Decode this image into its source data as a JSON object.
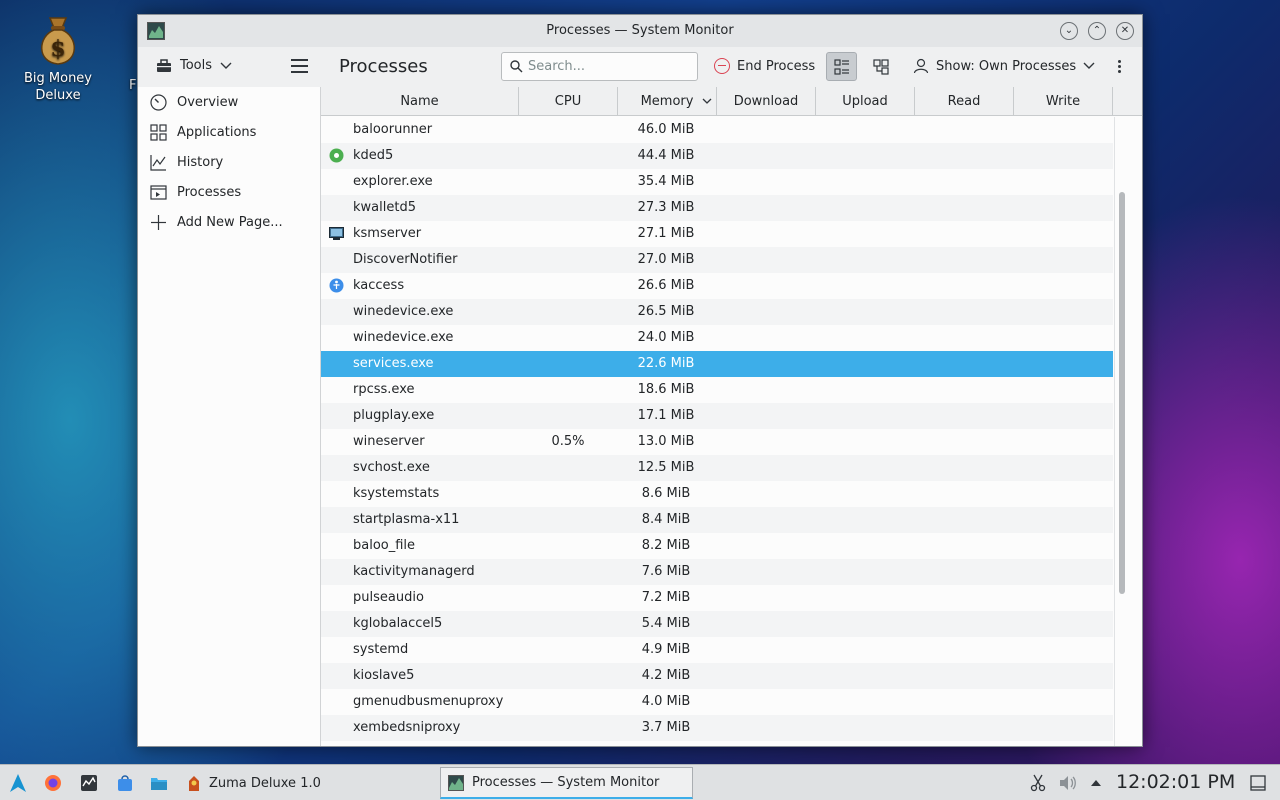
{
  "desktop": {
    "icon_label": "Big Money Deluxe",
    "partial_label": "F"
  },
  "window": {
    "title": "Processes — System Monitor"
  },
  "toolbar": {
    "tools_label": "Tools",
    "page_title": "Processes",
    "search_placeholder": "Search...",
    "end_process_label": "End Process",
    "show_label": "Show: Own Processes"
  },
  "sidebar": {
    "items": [
      {
        "label": "Overview",
        "icon": "gauge-icon"
      },
      {
        "label": "Applications",
        "icon": "grid-icon"
      },
      {
        "label": "History",
        "icon": "chart-icon"
      },
      {
        "label": "Processes",
        "icon": "process-icon"
      },
      {
        "label": "Add New Page...",
        "icon": "plus-icon"
      }
    ]
  },
  "table": {
    "columns": [
      "Name",
      "CPU",
      "Memory",
      "Download",
      "Upload",
      "Read",
      "Write"
    ],
    "rows": [
      {
        "name": "baloorunner",
        "cpu": "",
        "memory": "46.0 MiB"
      },
      {
        "name": "kded5",
        "cpu": "",
        "memory": "44.4 MiB"
      },
      {
        "name": "explorer.exe",
        "cpu": "",
        "memory": "35.4 MiB"
      },
      {
        "name": "kwalletd5",
        "cpu": "",
        "memory": "27.3 MiB"
      },
      {
        "name": "ksmserver",
        "cpu": "",
        "memory": "27.1 MiB"
      },
      {
        "name": "DiscoverNotifier",
        "cpu": "",
        "memory": "27.0 MiB"
      },
      {
        "name": "kaccess",
        "cpu": "",
        "memory": "26.6 MiB"
      },
      {
        "name": "winedevice.exe",
        "cpu": "",
        "memory": "26.5 MiB"
      },
      {
        "name": "winedevice.exe",
        "cpu": "",
        "memory": "24.0 MiB"
      },
      {
        "name": "services.exe",
        "cpu": "",
        "memory": "22.6 MiB"
      },
      {
        "name": "rpcss.exe",
        "cpu": "",
        "memory": "18.6 MiB"
      },
      {
        "name": "plugplay.exe",
        "cpu": "",
        "memory": "17.1 MiB"
      },
      {
        "name": "wineserver",
        "cpu": "0.5%",
        "memory": "13.0 MiB"
      },
      {
        "name": "svchost.exe",
        "cpu": "",
        "memory": "12.5 MiB"
      },
      {
        "name": "ksystemstats",
        "cpu": "",
        "memory": "8.6 MiB"
      },
      {
        "name": "startplasma-x11",
        "cpu": "",
        "memory": "8.4 MiB"
      },
      {
        "name": "baloo_file",
        "cpu": "",
        "memory": "8.2 MiB"
      },
      {
        "name": "kactivitymanagerd",
        "cpu": "",
        "memory": "7.6 MiB"
      },
      {
        "name": "pulseaudio",
        "cpu": "",
        "memory": "7.2 MiB"
      },
      {
        "name": "kglobalaccel5",
        "cpu": "",
        "memory": "5.4 MiB"
      },
      {
        "name": "systemd",
        "cpu": "",
        "memory": "4.9 MiB"
      },
      {
        "name": "kioslave5",
        "cpu": "",
        "memory": "4.2 MiB"
      },
      {
        "name": "gmenudbusmenuproxy",
        "cpu": "",
        "memory": "4.0 MiB"
      },
      {
        "name": "xembedsniproxy",
        "cpu": "",
        "memory": "3.7 MiB"
      }
    ]
  },
  "taskbar": {
    "launcher_label": "Zuma Deluxe 1.0",
    "task_label": "Processes — System Monitor",
    "clock": "12:02:01 PM"
  },
  "colors": {
    "selection": "#3daee9",
    "danger": "#da4453"
  }
}
